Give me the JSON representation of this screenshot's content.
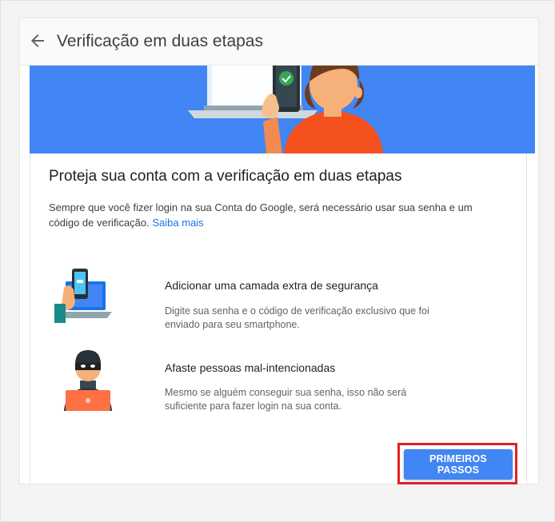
{
  "header": {
    "back_icon": "arrow-back-icon",
    "title": "Verificação em duas etapas"
  },
  "hero": {
    "background_color": "#4285f4",
    "illustration": "person-laptop-phone-checkmark"
  },
  "main": {
    "heading": "Proteja sua conta com a verificação em duas etapas",
    "description": "Sempre que você fizer login na sua Conta do Google, será necessário usar sua senha e um código de verificação.",
    "learn_more_link": "Saiba mais",
    "features": [
      {
        "icon": "laptop-phone-security-icon",
        "title": "Adicionar uma camada extra de segurança",
        "description": "Digite sua senha e o código de verificação exclusivo que foi enviado para seu smartphone."
      },
      {
        "icon": "masked-intruder-icon",
        "title": "Afaste pessoas mal-intencionadas",
        "description": "Mesmo se alguém conseguir sua senha, isso não será suficiente para fazer login na sua conta."
      }
    ],
    "cta_label": "PRIMEIROS PASSOS"
  },
  "colors": {
    "accent": "#4285f4",
    "link": "#1a73e8",
    "highlight_border": "#e0202a"
  }
}
